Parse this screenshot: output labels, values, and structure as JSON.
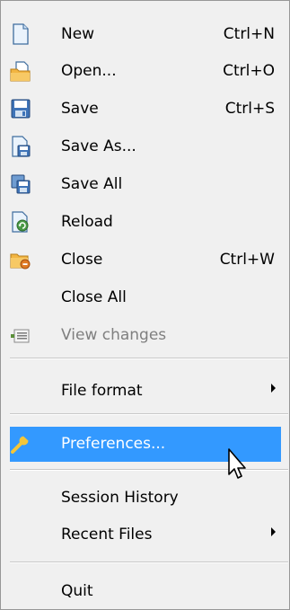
{
  "menu": {
    "items": [
      {
        "label": "New",
        "shortcut": "Ctrl+N",
        "icon": "new-file-icon"
      },
      {
        "label": "Open...",
        "shortcut": "Ctrl+O",
        "icon": "open-folder-icon"
      },
      {
        "label": "Save",
        "shortcut": "Ctrl+S",
        "icon": "save-icon"
      },
      {
        "label": "Save As...",
        "shortcut": "",
        "icon": "save-as-icon"
      },
      {
        "label": "Save All",
        "shortcut": "",
        "icon": "save-all-icon"
      },
      {
        "label": "Reload",
        "shortcut": "",
        "icon": "reload-icon"
      },
      {
        "label": "Close",
        "shortcut": "Ctrl+W",
        "icon": "close-file-icon"
      },
      {
        "label": "Close All",
        "shortcut": "",
        "icon": ""
      },
      {
        "label": "View changes",
        "shortcut": "",
        "icon": "view-changes-icon",
        "disabled": true
      },
      {
        "label": "File format",
        "submenu": true
      },
      {
        "label": "Preferences...",
        "icon": "wrench-icon",
        "highlighted": true
      },
      {
        "label": "Session History"
      },
      {
        "label": "Recent Files",
        "submenu": true
      },
      {
        "label": "Quit"
      }
    ]
  },
  "colors": {
    "menu_background": "#f0f0f0",
    "highlight": "#3399ff",
    "disabled_text": "#7f7f7f"
  }
}
